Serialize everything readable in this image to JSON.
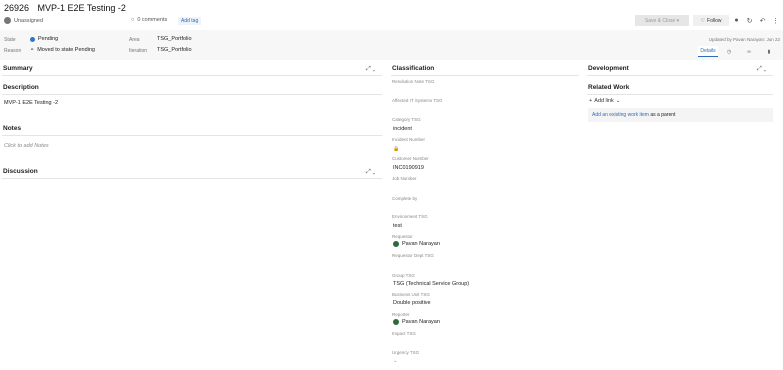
{
  "workitem": {
    "id": "26926",
    "title": "MVP-1 E2E Testing -2"
  },
  "assignee": "Unassigned",
  "comments": "0 comments",
  "add_tag": "Add tag",
  "toolbar": {
    "save_close": "Save & Close",
    "follow": "Follow"
  },
  "header_fields": {
    "state_label": "State",
    "state_value": "Pending",
    "reason_label": "Reason",
    "reason_value": "Moved to state Pending",
    "area_label": "Area",
    "area_value": "TSG_Portfolio",
    "iteration_label": "Iteration",
    "iteration_value": "TSG_Portfolio",
    "updated": "Updated by Pavan Narayan: Jun 22"
  },
  "tabs": {
    "details": "Details"
  },
  "sections": {
    "summary": "Summary",
    "description": "Description",
    "notes": "Notes",
    "discussion": "Discussion",
    "classification": "Classification",
    "development": "Development",
    "related_work": "Related Work"
  },
  "description_text": "MVP-1 E2E Testing -2",
  "notes_placeholder": "Click to add Notes",
  "classification_fields": [
    {
      "label": "Resolution Note TSG",
      "value": ""
    },
    {
      "label": "Affected IT Systems TSG",
      "value": ""
    },
    {
      "label": "Category TSG",
      "value": "incident"
    },
    {
      "label": "Incident Number",
      "value": ""
    },
    {
      "label": "Customer Number",
      "value": "INC0190919"
    },
    {
      "label": "Job Number",
      "value": ""
    },
    {
      "label": "Complete by",
      "value": ""
    },
    {
      "label": "Environment TSG",
      "value": "test"
    },
    {
      "label": "Requestor",
      "value": "Pavan Narayan"
    },
    {
      "label": "Requestor Dept TSG",
      "value": ""
    },
    {
      "label": "Group TSG",
      "value": "TSG (Technical Service Group)"
    },
    {
      "label": "Business Unit TSG",
      "value": "Double positive"
    },
    {
      "label": "Reporter",
      "value": "Pavan Narayan"
    },
    {
      "label": "Impact TSG",
      "value": ""
    },
    {
      "label": "Urgency TSG",
      "value": ""
    }
  ],
  "related": {
    "add_link": "Add link",
    "add_parent_link": "Add an existing work item",
    "add_parent_suffix": "as a parent"
  },
  "colors": {
    "accent": "#2d6db5",
    "state_dot": "#2f78c4",
    "avatar": "#2d6b3a"
  }
}
